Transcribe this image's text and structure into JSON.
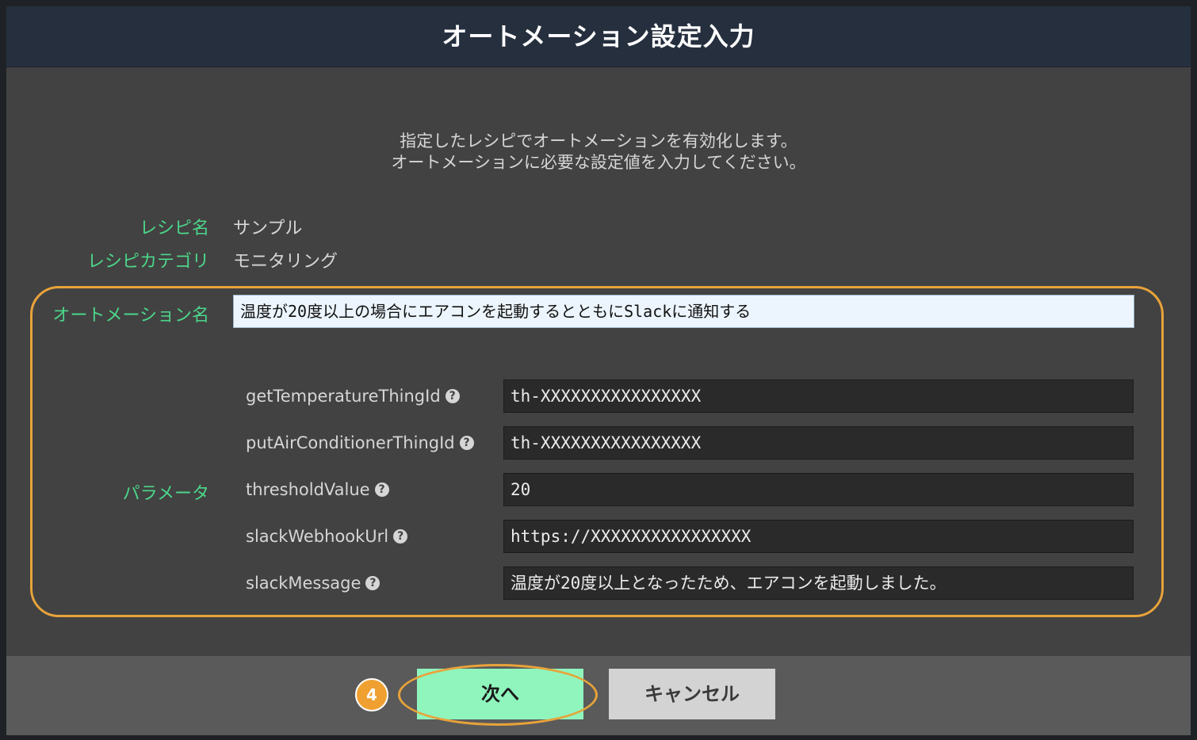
{
  "dialog": {
    "title": "オートメーション設定入力",
    "intro_line1": "指定したレシピでオートメーションを有効化します。",
    "intro_line2": "オートメーションに必要な設定値を入力してください。"
  },
  "recipe": {
    "name_label": "レシピ名",
    "name_value": "サンプル",
    "category_label": "レシピカテゴリ",
    "category_value": "モニタリング"
  },
  "automation": {
    "name_label": "オートメーション名",
    "name_value": "温度が20度以上の場合にエアコンを起動するとともにSlackに通知する"
  },
  "parameters": {
    "section_label": "パラメータ",
    "items": [
      {
        "label": "getTemperatureThingId",
        "value": "th-XXXXXXXXXXXXXXXX",
        "icon": "question-circle-icon"
      },
      {
        "label": "putAirConditionerThingId",
        "value": "th-XXXXXXXXXXXXXXXX",
        "icon": "question-circle-icon"
      },
      {
        "label": "thresholdValue",
        "value": "20",
        "icon": "question-circle-icon"
      },
      {
        "label": "slackWebhookUrl",
        "value": "https://XXXXXXXXXXXXXXXX",
        "icon": "question-circle-icon"
      },
      {
        "label": "slackMessage",
        "value": "温度が20度以上となったため、エアコンを起動しました。",
        "icon": "question-circle-icon"
      }
    ]
  },
  "buttons": {
    "next_label": "次へ",
    "cancel_label": "キャンセル"
  },
  "annotation": {
    "step_number": "4"
  },
  "colors": {
    "header_bg": "#252f3e",
    "body_bg": "#424242",
    "label_green": "#4cd68a",
    "highlight_orange": "#e8a33a",
    "next_button_bg": "#8ff5bd",
    "cancel_button_bg": "#d3d3d3"
  }
}
